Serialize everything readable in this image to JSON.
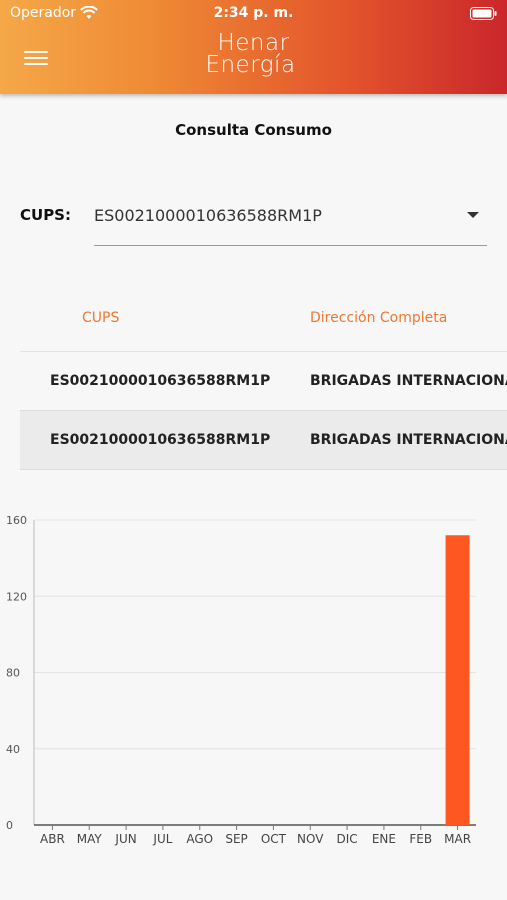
{
  "status": {
    "carrier": "Operador",
    "time": "2:34 p. m."
  },
  "header": {
    "logo_line1": "Henar",
    "logo_line2": "Energía"
  },
  "page": {
    "title": "Consulta Consumo"
  },
  "cups": {
    "label": "CUPS:",
    "selected": "ES0021000010636588RM1P"
  },
  "table": {
    "headers": [
      "CUPS",
      "Dirección Completa"
    ],
    "rows": [
      [
        "ES0021000010636588RM1P",
        "BRIGADAS INTERNACIONALES"
      ],
      [
        "ES0021000010636588RM1P",
        "BRIGADAS INTERNACIONALES"
      ]
    ]
  },
  "colors": {
    "accent": "#ee7733",
    "bar": "#ff5722"
  },
  "chart_data": {
    "type": "bar",
    "categories": [
      "ABR",
      "MAY",
      "JUN",
      "JUL",
      "AGO",
      "SEP",
      "OCT",
      "NOV",
      "DIC",
      "ENE",
      "FEB",
      "MAR"
    ],
    "values": [
      0,
      0,
      0,
      0,
      0,
      0,
      0,
      0,
      0,
      0,
      0,
      152
    ],
    "ylim": [
      0,
      160
    ],
    "yticks": [
      0,
      40,
      80,
      120,
      160
    ],
    "grid": true
  }
}
